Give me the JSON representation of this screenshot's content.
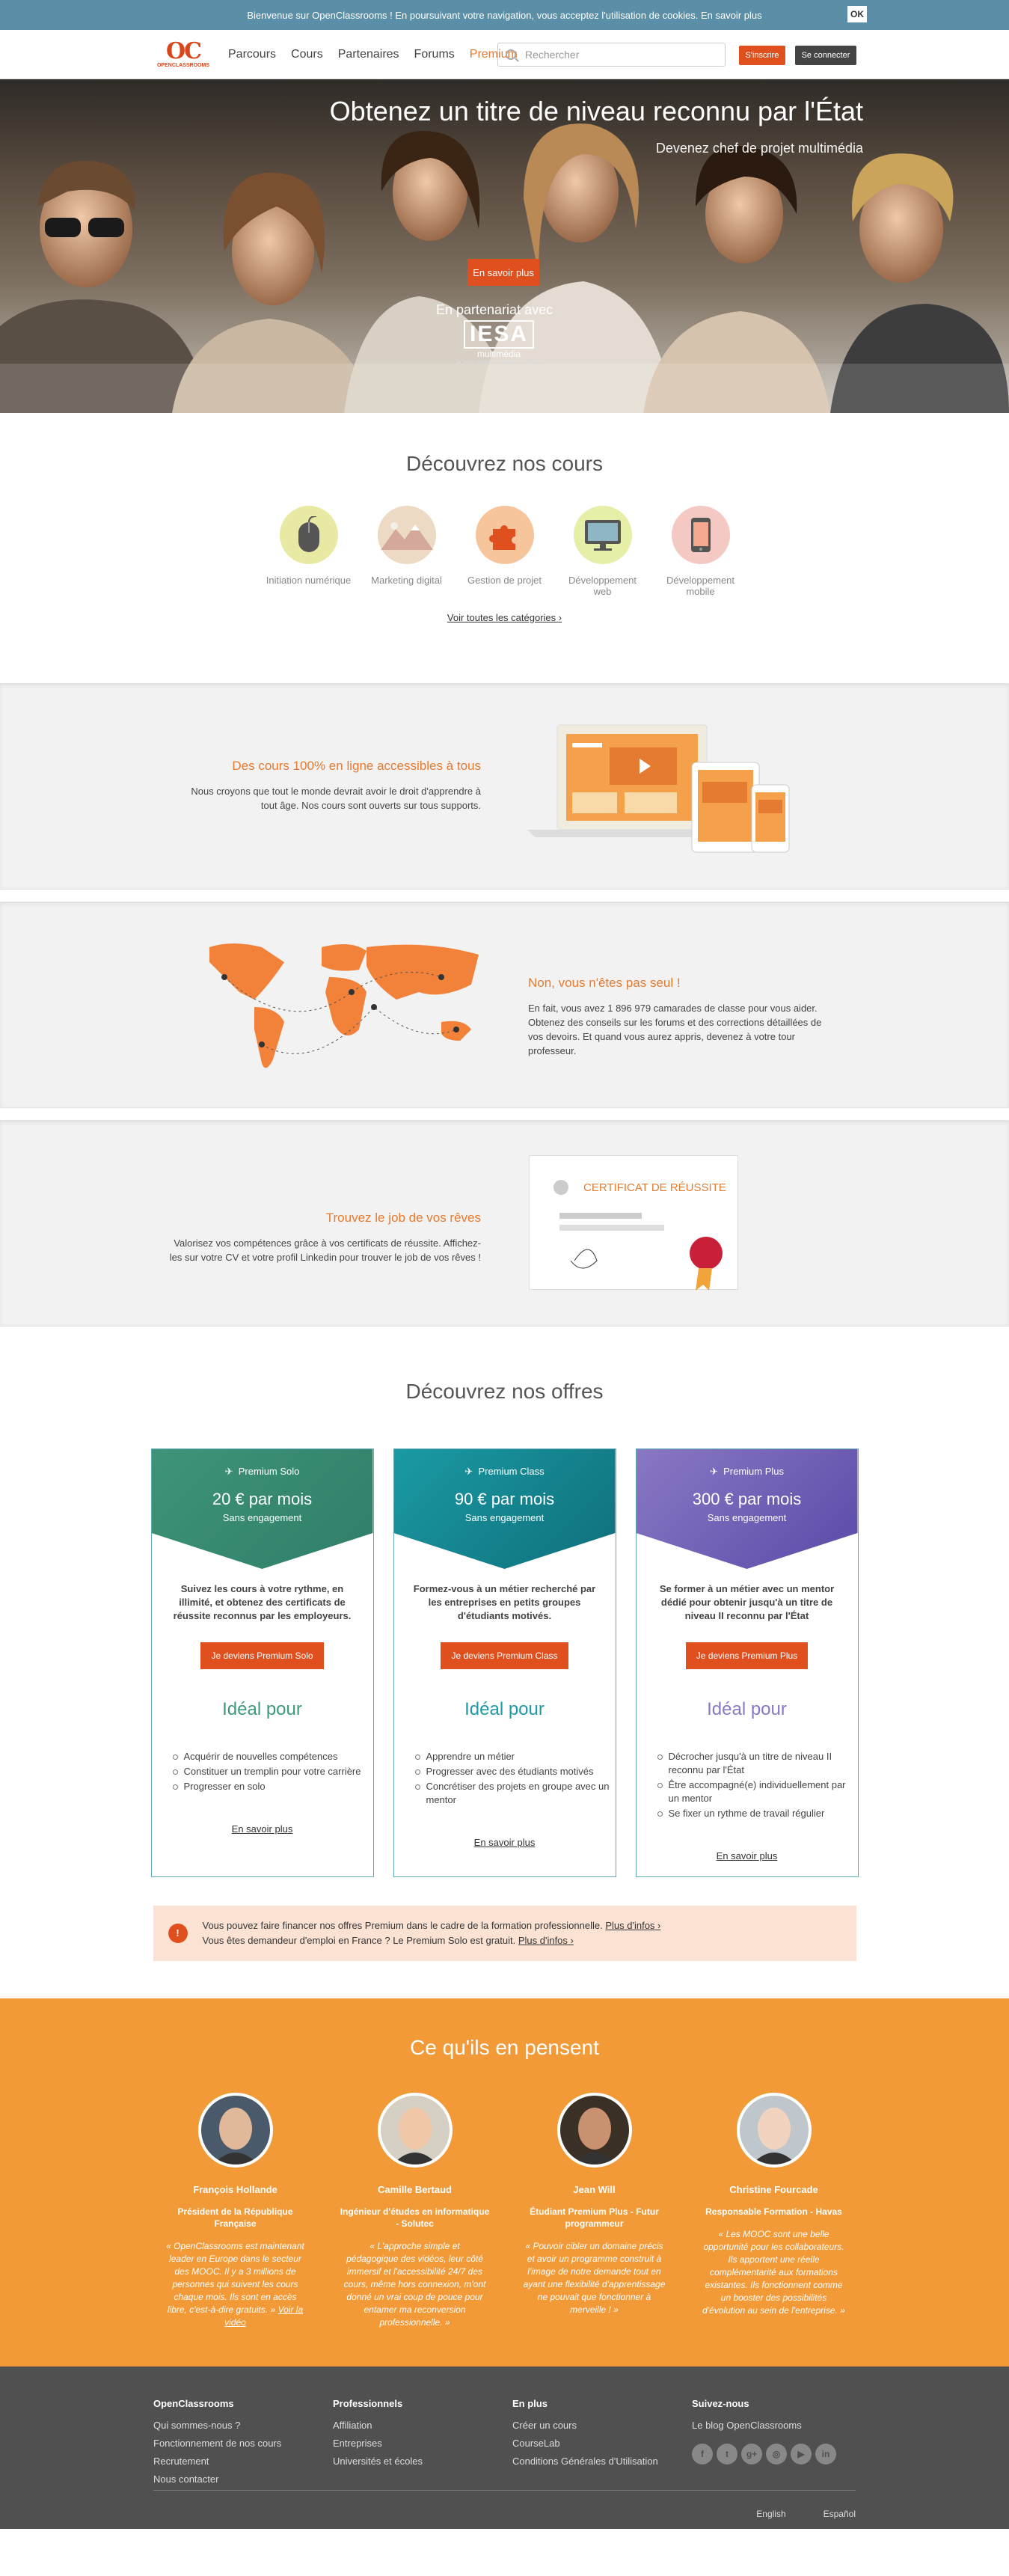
{
  "cookie": {
    "text": "Bienvenue sur OpenClassrooms ! En poursuivant votre navigation, vous acceptez l'utilisation de cookies. En savoir plus",
    "ok": "OK"
  },
  "nav": {
    "logo": "OC",
    "logo_text": "OPENCLASSROOMS",
    "links": [
      "Parcours",
      "Cours",
      "Partenaires",
      "Forums",
      "Premium"
    ],
    "search_placeholder": "Rechercher",
    "signup": "S'inscrire",
    "login": "Se connecter"
  },
  "hero": {
    "title": "Obtenez un titre de niveau reconnu par l'État",
    "subtitle": "Devenez chef de projet multimédia",
    "cta": "En savoir plus",
    "partner": "En partenariat avec",
    "iesa": "IESA",
    "iesa_sub": "multimédia",
    "iesa_tag": "la 1ère école multimédia à Paris"
  },
  "courses": {
    "title": "Découvrez nos cours",
    "categories": [
      {
        "label": "Initiation numérique",
        "color": "#e8e9a3",
        "icon": "mouse-icon"
      },
      {
        "label": "Marketing digital",
        "color": "#eddac4",
        "icon": "mountains-icon"
      },
      {
        "label": "Gestion de projet",
        "color": "#f6c59c",
        "icon": "puzzle-icon"
      },
      {
        "label": "Développement web",
        "color": "#e6eea8",
        "icon": "monitor-icon"
      },
      {
        "label": "Développement mobile",
        "color": "#f4c9c4",
        "icon": "phone-icon"
      }
    ],
    "see_all": "Voir toutes les catégories"
  },
  "feature1": {
    "title": "Des cours 100% en ligne accessibles à tous",
    "text": "Nous croyons que tout le monde devrait avoir le droit d'apprendre à tout âge. Nos cours sont ouverts sur tous supports."
  },
  "feature2": {
    "title": "Non, vous n'êtes pas seul !",
    "text": "En fait, vous avez 1 896 979 camarades de classe pour vous aider. Obtenez des conseils sur les forums et des corrections détaillées de vos devoirs. Et quand vous aurez appris, devenez à votre tour professeur."
  },
  "feature3": {
    "title": "Trouvez le job de vos rêves",
    "text": "Valorisez vos compétences grâce à vos certificats de réussite. Affichez-les sur votre CV et votre profil Linkedin pour trouver le job de vos rêves !",
    "certificate": "CERTIFICAT DE RÉUSSITE"
  },
  "offers": {
    "title": "Découvrez nos offres",
    "ideal": "Idéal pour",
    "more": "En savoir plus",
    "items": [
      {
        "name": "Premium Solo",
        "price": "20 € par mois",
        "engagement": "Sans engagement",
        "desc": "Suivez les cours à votre rythme, en illimité, et obtenez des certificats de réussite reconnus par les employeurs.",
        "button": "Je deviens Premium Solo",
        "color1": "#3e9478",
        "color2": "#2f7e6a",
        "ideal_color": "#3c9a7c",
        "list": [
          "Acquérir de nouvelles compétences",
          "Constituer un tremplin pour votre carrière",
          "Progresser en solo"
        ]
      },
      {
        "name": "Premium Class",
        "price": "90 € par mois",
        "engagement": "Sans engagement",
        "desc": "Formez-vous à un métier recherché par les entreprises en petits groupes d'étudiants motivés.",
        "button": "Je deviens Premium Class",
        "color1": "#1a9aa3",
        "color2": "#0f6f7c",
        "ideal_color": "#1e9aa7",
        "list": [
          "Apprendre un métier",
          "Progresser avec des étudiants motivés",
          "Concrétiser des projets en groupe avec un mentor"
        ]
      },
      {
        "name": "Premium Plus",
        "price": "300 € par mois",
        "engagement": "Sans engagement",
        "desc": "Se former à un métier avec un mentor dédié pour obtenir jusqu'à un titre de niveau II reconnu par l'État",
        "button": "Je deviens Premium Plus",
        "color1": "#8a78c4",
        "color2": "#5b4aa8",
        "ideal_color": "#8a78c4",
        "list": [
          "Décrocher jusqu'à un titre de niveau II reconnu par l'État",
          "Être accompagné(e) individuellement par un mentor",
          "Se fixer un rythme de travail régulier"
        ]
      }
    ]
  },
  "finance": {
    "line1": "Vous pouvez faire financer nos offres Premium dans le cadre de la formation professionnelle.",
    "link1": "Plus d'infos",
    "line2": "Vous êtes demandeur d'emploi en France ? Le Premium Solo est gratuit.",
    "link2": "Plus d'infos",
    "icon": "!"
  },
  "testimonials": {
    "title": "Ce qu'ils en pensent",
    "people": [
      {
        "name": "François Hollande",
        "role": "Président de la République Française",
        "quote": "« OpenClassrooms est maintenant leader en Europe dans le secteur des MOOC. Il y a 3 millions de personnes qui suivent les cours chaque mois. Ils sont en accès libre, c'est-à-dire gratuits. »",
        "link": "Voir la vidéo",
        "bg": "#4a5a6a",
        "skin": "#e0b89a"
      },
      {
        "name": "Camille Bertaud",
        "role": "Ingénieur d'études en informatique - Solutec",
        "quote": "« L'approche simple et pédagogique des vidéos, leur côté immersif et l'accessibilité 24/7 des cours, même hors connexion, m'ont donné un vrai coup de pouce pour entamer ma reconversion professionnelle. »",
        "link": "",
        "bg": "#d6cfc4",
        "skin": "#f0c8a8"
      },
      {
        "name": "Jean Will",
        "role": "Étudiant Premium Plus - Futur programmeur",
        "quote": "« Pouvoir cibler un domaine précis et avoir un programme construit à l'image de notre demande tout en ayant une flexibilité d'apprentissage ne pouvait que fonctionner à merveille ! »",
        "link": "",
        "bg": "#3a3025",
        "skin": "#c89270"
      },
      {
        "name": "Christine Fourcade",
        "role": "Responsable Formation - Havas",
        "quote": "« Les MOOC sont une belle opportunité pour les collaborateurs. Ils apportent une réelle complémentarité aux formations existantes. Ils fonctionnent comme un booster des possibilités d'évolution au sein de l'entreprise. »",
        "link": "",
        "bg": "#bfc6cc",
        "skin": "#f0d4c0"
      }
    ]
  },
  "footer": {
    "cols": [
      {
        "title": "OpenClassrooms",
        "links": [
          "Qui sommes-nous ?",
          "Fonctionnement de nos cours",
          "Recrutement",
          "Nous contacter"
        ]
      },
      {
        "title": "Professionnels",
        "links": [
          "Affiliation",
          "Entreprises",
          "Universités et écoles"
        ]
      },
      {
        "title": "En plus",
        "links": [
          "Créer un cours",
          "CourseLab",
          "Conditions Générales d'Utilisation"
        ]
      },
      {
        "title": "Suivez-nous",
        "links": [
          "Le blog OpenClassrooms"
        ]
      }
    ],
    "social": [
      "f",
      "t",
      "g+",
      "◎",
      "▶",
      "in"
    ],
    "langs": [
      "English",
      "Español"
    ]
  }
}
